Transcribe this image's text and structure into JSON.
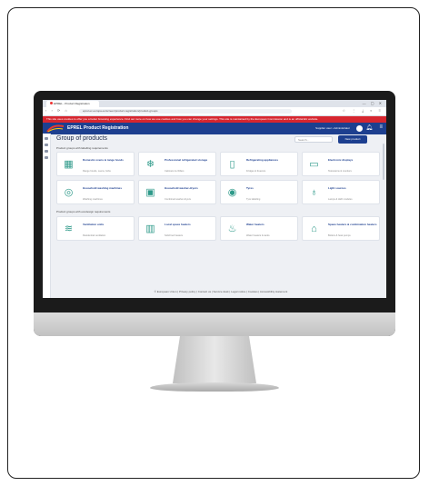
{
  "browser": {
    "tab_label": "EPREL - Product Registration",
    "window_controls": "— ▢ ✕",
    "nav_icons": "‹ › ⟳ ⌂",
    "url": "eprel.ec.europa.eu/screen/product-registration/product-groups",
    "toolbar_icons": "☆ ⋮ ⤓ ◐ ≡"
  },
  "notice": "This site uses cookies to offer you a better browsing experience. Find out more on how we use cookies and how you can change your settings. This site is maintained by the European Commission and is an official EU website.",
  "header": {
    "title": "EPREL Product Registration",
    "user": "Supplier user • Administrator",
    "bell_icon": "bell-icon",
    "menu_icon": "menu-icon"
  },
  "page": {
    "title": "Group of products",
    "search_placeholder": "Search...",
    "new_button": "New product",
    "section1_label": "Product groups with labelling requirements",
    "section2_label": "Product groups with ecodesign requirements",
    "footer": "© European Union  |  Privacy policy  |  Contact us  |  Service desk  |  Legal notice  |  Cookies  |  Accessibility statement"
  },
  "section1": [
    {
      "title": "Domestic ovens & range hoods",
      "sub": "Range hoods, ovens, hobs",
      "icon": "▦"
    },
    {
      "title": "Professional refrigerated storage",
      "sub": "Cabinets & chillers",
      "icon": "❄"
    },
    {
      "title": "Refrigerating appliances",
      "sub": "Fridges & freezers",
      "icon": "▯"
    },
    {
      "title": "Electronic displays",
      "sub": "Televisions & monitors",
      "icon": "▭"
    },
    {
      "title": "Household washing machines",
      "sub": "Washing machines",
      "icon": "◎"
    },
    {
      "title": "Household washer-dryers",
      "sub": "Combined washer-dryers",
      "icon": "▣"
    },
    {
      "title": "Tyres",
      "sub": "Tyre labelling",
      "icon": "◉"
    },
    {
      "title": "Light sources",
      "sub": "Lamps & LED modules",
      "icon": "♁"
    }
  ],
  "section2": [
    {
      "title": "Ventilation units",
      "sub": "Residential ventilation",
      "icon": "≋"
    },
    {
      "title": "Local space heaters",
      "sub": "Solid fuel heaters",
      "icon": "▥"
    },
    {
      "title": "Water heaters",
      "sub": "Water heaters & tanks",
      "icon": "♨"
    },
    {
      "title": "Space heaters & combination heaters",
      "sub": "Boilers & heat pumps",
      "icon": "⌂"
    }
  ]
}
